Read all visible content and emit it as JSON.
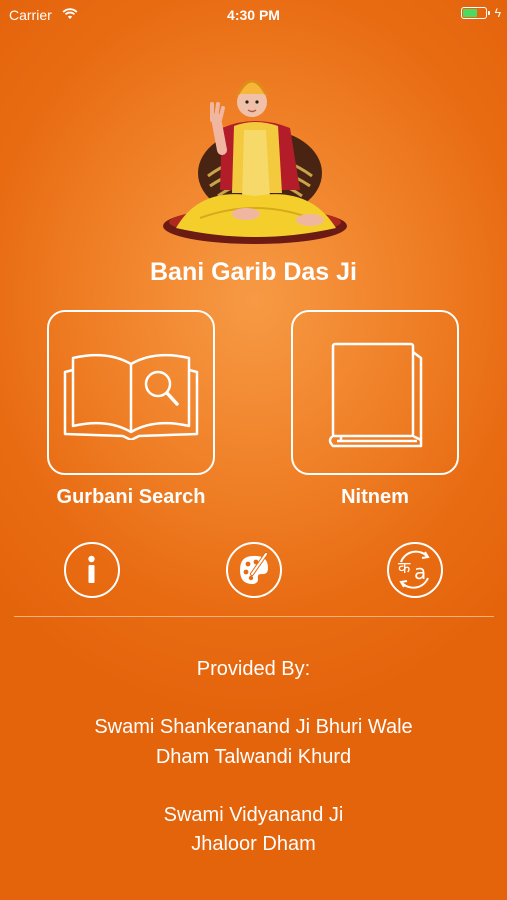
{
  "status_bar": {
    "carrier": "Carrier",
    "time": "4:30 PM"
  },
  "app": {
    "title": "Bani Garib Das Ji"
  },
  "tiles": [
    {
      "label": "Gurbani Search",
      "icon": "open-book-search-icon"
    },
    {
      "label": "Nitnem",
      "icon": "closed-book-icon"
    }
  ],
  "actions": [
    {
      "icon": "info-icon"
    },
    {
      "icon": "palette-icon"
    },
    {
      "icon": "language-switch-icon",
      "glyph_primary": "क",
      "glyph_secondary": "a"
    }
  ],
  "footer": {
    "heading": "Provided By:",
    "provider1_line1": "Swami Shankeranand Ji Bhuri Wale",
    "provider1_line2": "Dham Talwandi Khurd",
    "provider2_line1": "Swami Vidyanand Ji",
    "provider2_line2": "Jhaloor Dham"
  },
  "colors": {
    "background": "#e86b12",
    "foreground": "#ffffff",
    "battery": "#4cd964"
  }
}
